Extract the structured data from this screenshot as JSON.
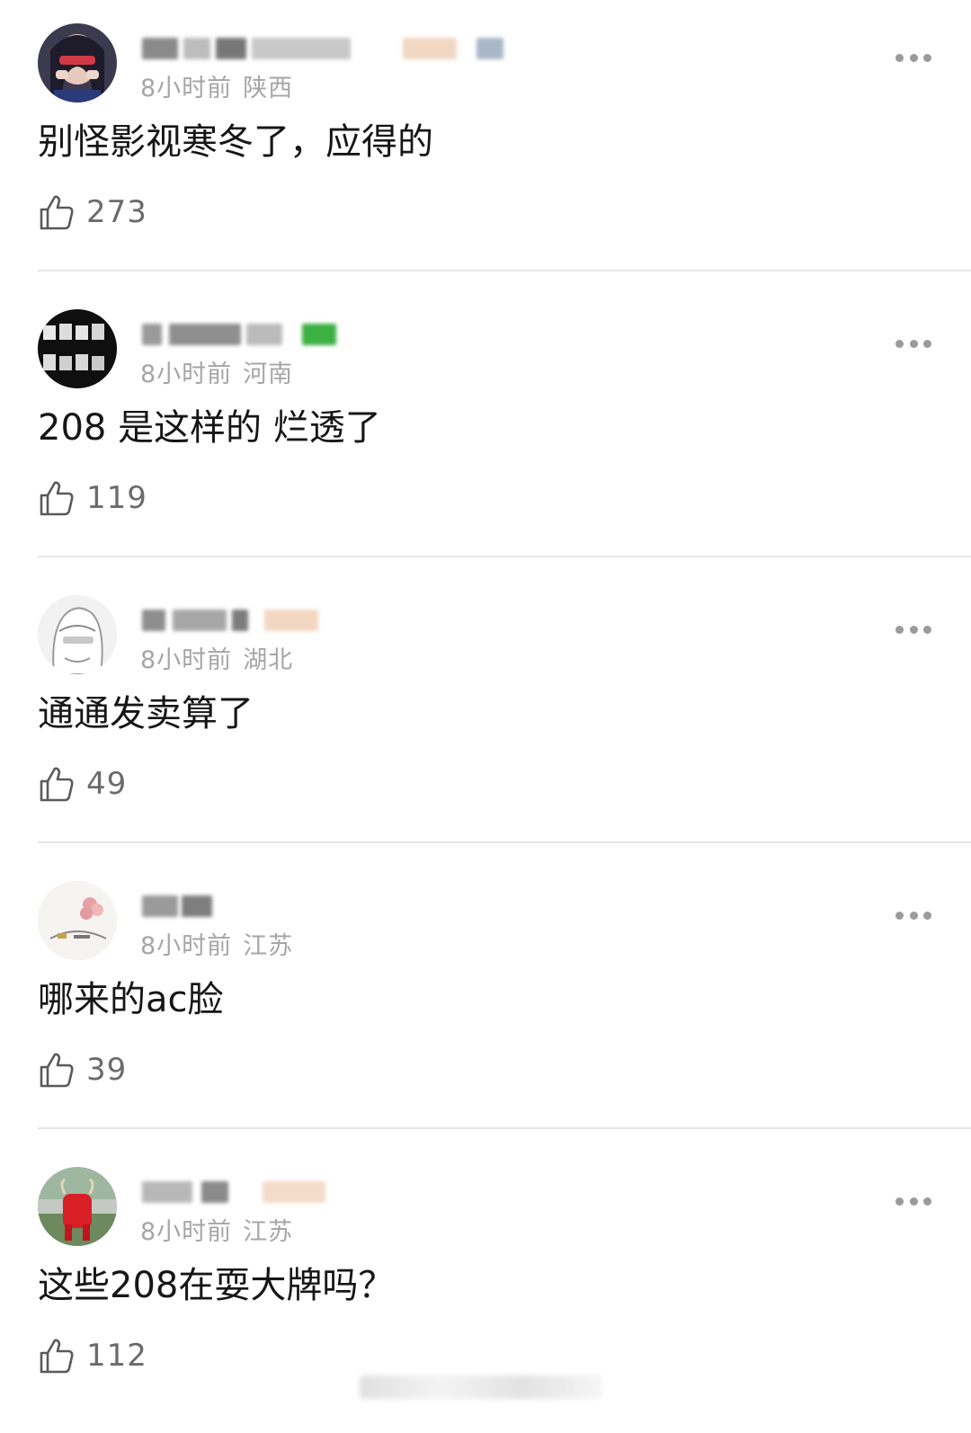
{
  "comments": [
    {
      "time": "8小时前",
      "location": "陕西",
      "text": "别怪影视寒冬了，应得的",
      "likes": "273",
      "avatar": "girl-with-red-sunglasses-avatar"
    },
    {
      "time": "8小时前",
      "location": "河南",
      "text": "208 是这样的 烂透了",
      "likes": "119",
      "avatar": "black-calligraphy-text-avatar"
    },
    {
      "time": "8小时前",
      "location": "湖北",
      "text": "通通发卖算了",
      "likes": "49",
      "avatar": "anime-sketch-girl-avatar"
    },
    {
      "time": "8小时前",
      "location": "江苏",
      "text": "哪来的ac脸",
      "likes": "39",
      "avatar": "pink-flower-illustration-avatar"
    },
    {
      "time": "8小时前",
      "location": "江苏",
      "text": "这些208在耍大牌吗？",
      "likes": "112",
      "avatar": "red-bull-statue-avatar"
    }
  ],
  "colors": {
    "meta_text": "#a6a6a6",
    "like_count": "#6b6b6b",
    "divider": "#e6e6e6",
    "more_dots": "#9a9a9a"
  },
  "icons": {
    "like": "thumbs-up-icon",
    "more": "more-dots-icon"
  }
}
